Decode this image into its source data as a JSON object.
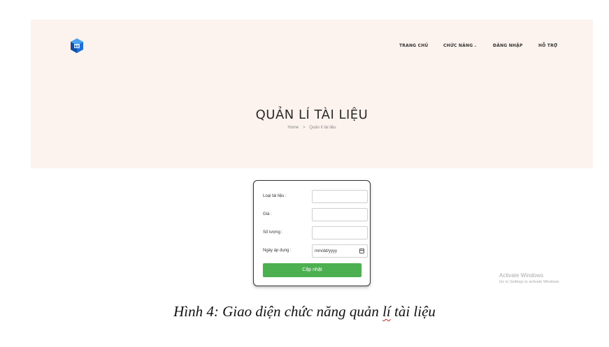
{
  "brand": {
    "logo_icon": "hexagon-cube-logo-icon",
    "logo_text": "BK",
    "accent": "#1e6fd9"
  },
  "nav": {
    "home": "TRANG CHỦ",
    "features": "CHỨC NĂNG",
    "features_chevron": "⌄",
    "login": "ĐĂNG NHẬP",
    "support": "HỖ TRỢ"
  },
  "hero": {
    "title": "QUẢN LÍ TÀI LIỆU",
    "breadcrumb_home": "Home",
    "breadcrumb_sep": ">",
    "breadcrumb_current": "Quản lí tài liệu",
    "background": "#fdf3ee"
  },
  "form": {
    "doc_type_label": "Loại tài liệu :",
    "doc_type_value": "",
    "price_label": "Giá :",
    "price_value": "",
    "quantity_label": "Số lượng :",
    "quantity_value": "",
    "date_label": "Ngày áp dụng :",
    "date_placeholder": "mm/dd/yyyy",
    "submit_label": "Cập nhật",
    "submit_color": "#4caf50"
  },
  "watermark": {
    "line1": "Activate Windows",
    "line2": "Go to Settings to activate Windows."
  },
  "caption": {
    "prefix": "Hình 4: Giao diện chức năng quản ",
    "marked": "lí",
    "suffix": " tài liệu"
  }
}
